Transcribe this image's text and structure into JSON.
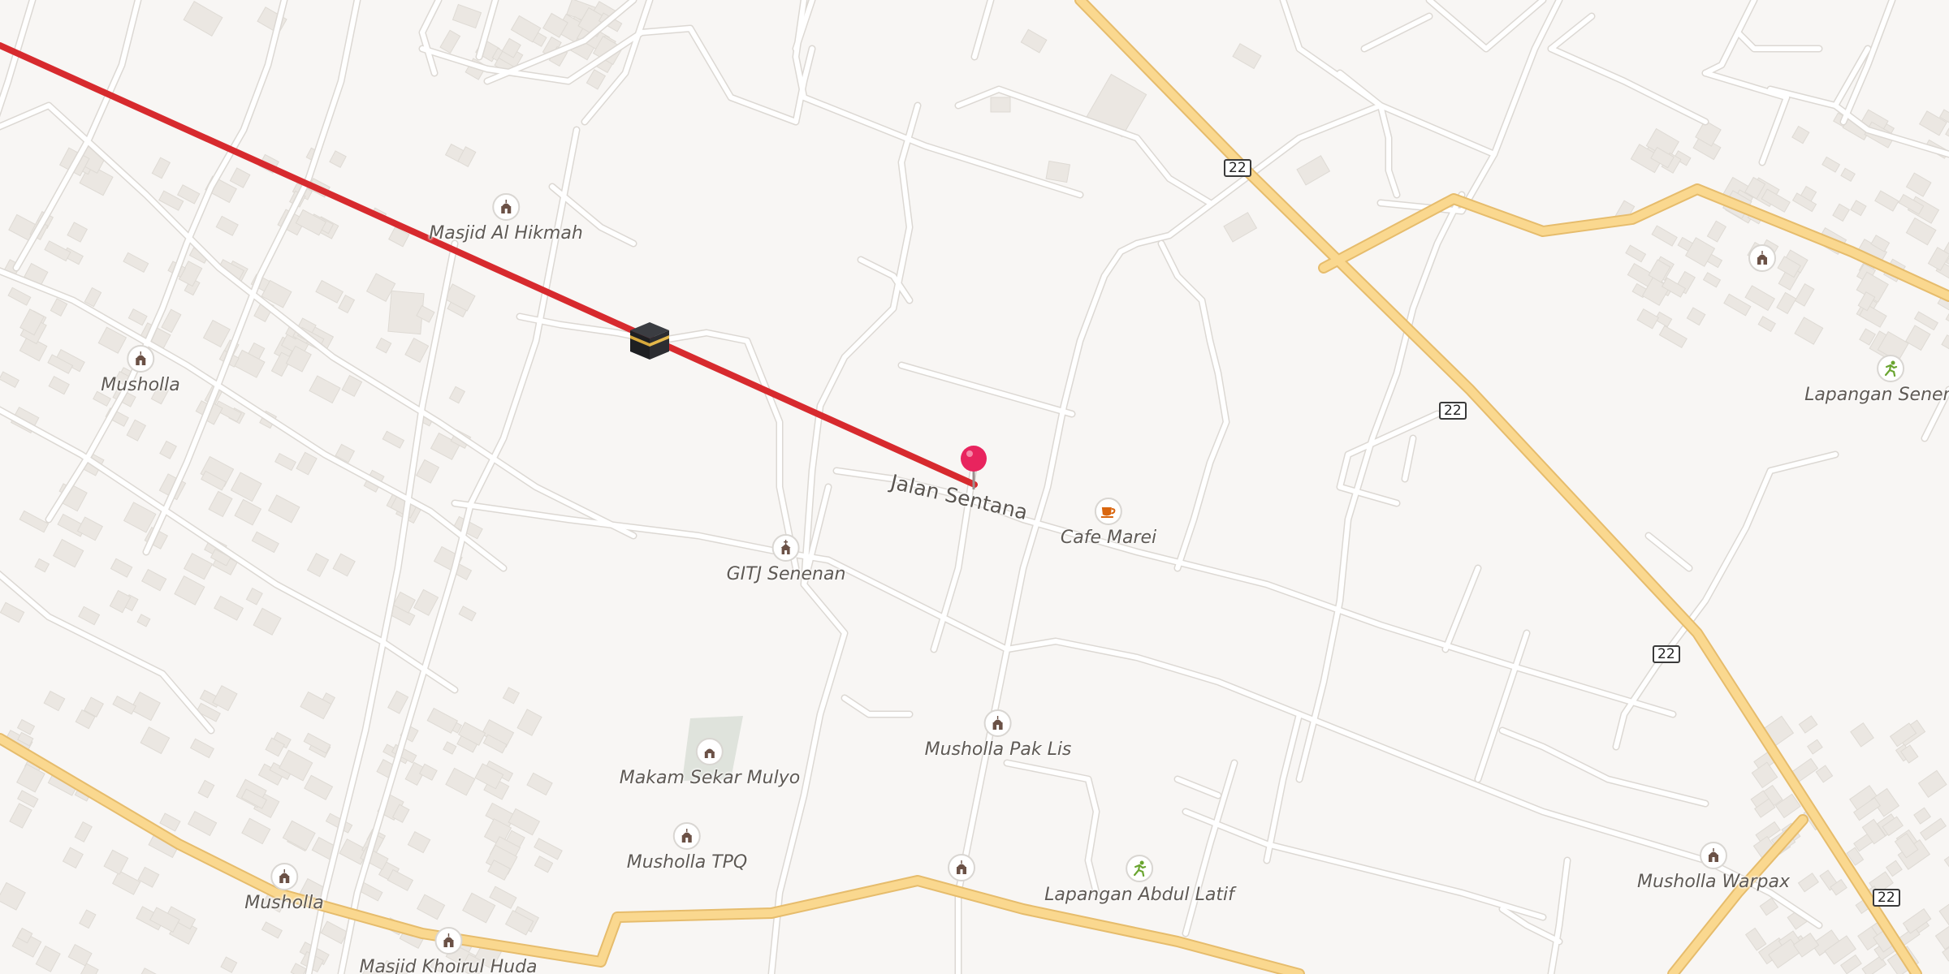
{
  "colors": {
    "background": "#f8f6f4",
    "route": "#d72a2e",
    "major_road": "#fad88f",
    "pin": "#e8245e",
    "poi_brown": "#6b5146",
    "poi_green": "#6aa531",
    "cafe_orange": "#d9660f"
  },
  "route_line": {
    "icon": "kaaba-icon"
  },
  "pin": {
    "icon": "location-pin-icon"
  },
  "streets": {
    "jalan_sentana": "Jalan Sentana"
  },
  "shields": [
    "22",
    "22",
    "22",
    "22"
  ],
  "pois": [
    {
      "name": "Masjid Al Hikmah",
      "icon": "mosque-icon"
    },
    {
      "name": "Musholla",
      "icon": "mosque-icon"
    },
    {
      "name": "GITJ Senenan",
      "icon": "church-icon"
    },
    {
      "name": "Cafe Marei",
      "icon": "cafe-icon"
    },
    {
      "name": "Lapangan Senenan",
      "icon": "sports-icon"
    },
    {
      "name": "Musholla Pak Lis",
      "icon": "mosque-icon"
    },
    {
      "name": "Makam Sekar Mulyo",
      "icon": "cemetery-icon"
    },
    {
      "name": "Musholla TPQ",
      "icon": "mosque-icon"
    },
    {
      "name": "Musholla",
      "icon": "mosque-icon"
    },
    {
      "name": "Masjid Khoirul Huda",
      "icon": "mosque-icon"
    },
    {
      "name": "",
      "icon": "mosque-icon"
    },
    {
      "name": "Lapangan Abdul Latif",
      "icon": "sports-icon"
    },
    {
      "name": "Musholla Warpax",
      "icon": "mosque-icon"
    },
    {
      "name": "",
      "icon": "mosque-icon"
    }
  ]
}
